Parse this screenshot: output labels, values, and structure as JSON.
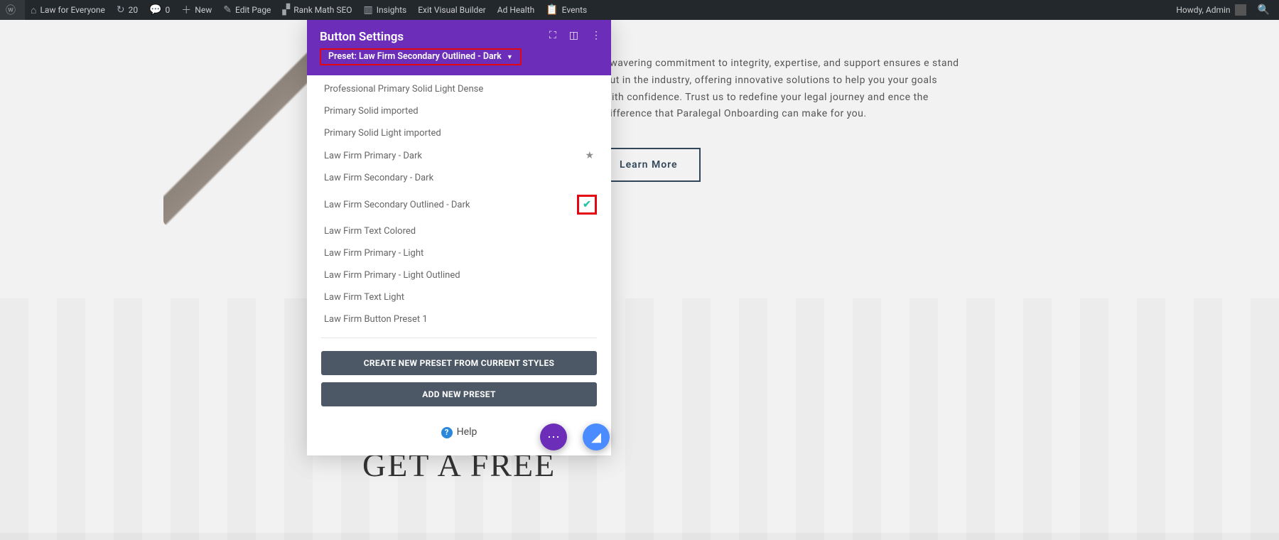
{
  "adminbar": {
    "site_name": "Law for Everyone",
    "updates_count": "20",
    "comments_count": "0",
    "new_label": "New",
    "edit_page": "Edit Page",
    "rank_math": "Rank Math SEO",
    "insights": "Insights",
    "exit_builder": "Exit Visual Builder",
    "ad_health": "Ad Health",
    "events": "Events",
    "howdy": "Howdy, Admin"
  },
  "page": {
    "paragraph": "nwavering commitment to integrity, expertise, and support ensures e stand out in the industry, offering innovative solutions to help you your goals with confidence. Trust us to redefine your legal journey and ence the difference that Paralegal Onboarding can make for you.",
    "learn_more": "Learn More",
    "heading_free": "GET A FREE"
  },
  "modal": {
    "title": "Button Settings",
    "preset_label": "Preset: Law Firm Secondary Outlined - Dark",
    "caret": "▼",
    "items": [
      "Professional Primary Solid Light Dense",
      "Primary Solid imported",
      "Primary Solid Light imported",
      "Law Firm Primary - Dark",
      "Law Firm Secondary - Dark",
      "Law Firm Secondary Outlined - Dark",
      "Law Firm Text Colored",
      "Law Firm Primary - Light",
      "Law Firm Primary - Light Outlined",
      "Law Firm Text Light",
      "Law Firm Button Preset 1"
    ],
    "create_preset": "CREATE NEW PRESET FROM CURRENT STYLES",
    "add_preset": "ADD NEW PRESET",
    "help": "Help"
  }
}
